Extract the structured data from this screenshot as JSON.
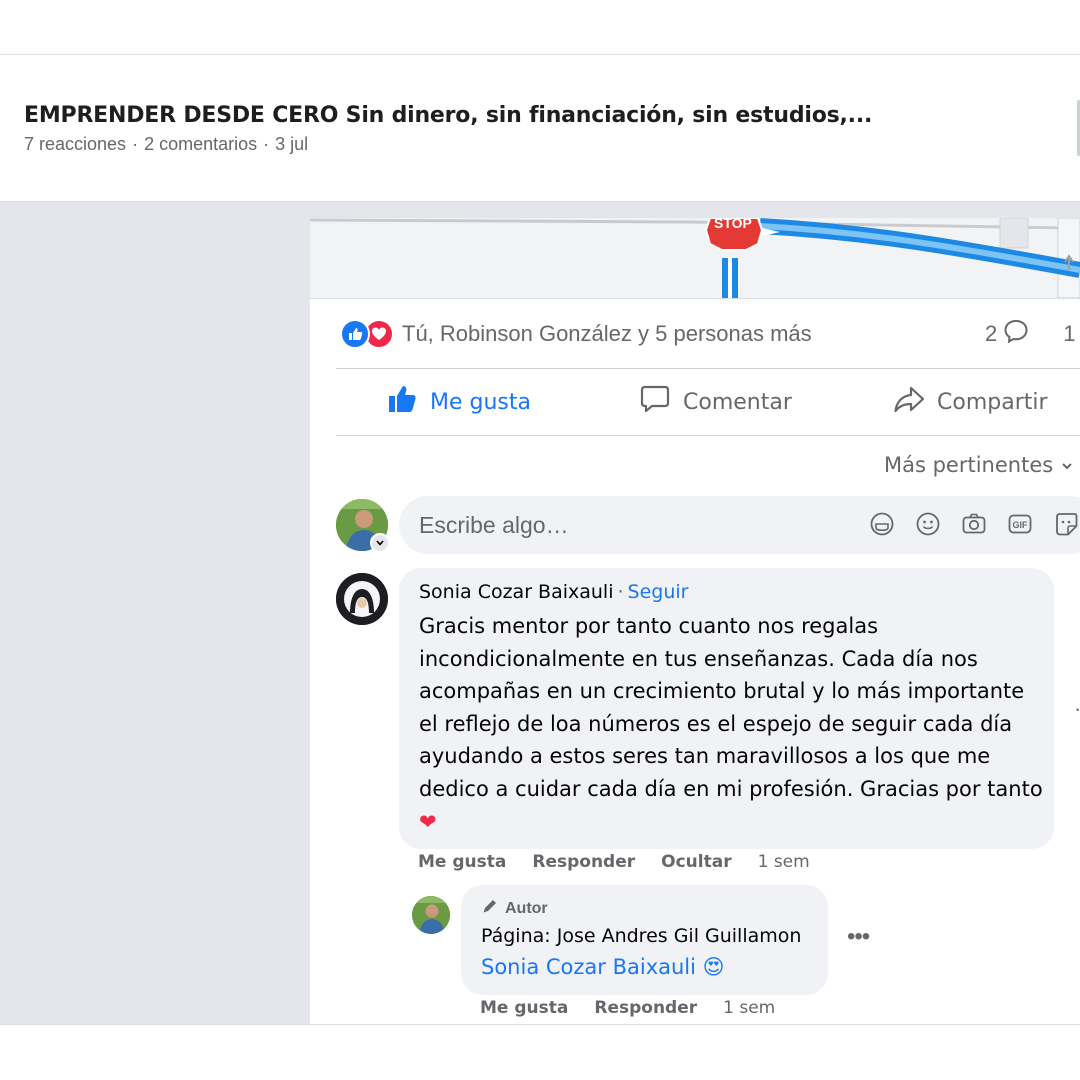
{
  "post": {
    "title": "EMPRENDER DESDE CERO Sin dinero, sin financiación, sin estudios,...",
    "reactions_count": "7 reacciones",
    "comments_count": "2 comentarios",
    "date": "3 jul"
  },
  "image": {
    "stop_sign_text": "STOP"
  },
  "engagement": {
    "reactors_text": "Tú, Robinson González y 5 personas más",
    "comments_number": "2",
    "shares_number": "1"
  },
  "actions": {
    "like": "Me gusta",
    "comment": "Comentar",
    "share": "Compartir"
  },
  "sort": {
    "label": "Más pertinentes"
  },
  "composer": {
    "placeholder": "Escribe algo…",
    "icons": [
      "sticker-icon",
      "emoji-icon",
      "camera-icon",
      "gif-icon",
      "avatar-sticker-icon"
    ]
  },
  "comments": [
    {
      "author": "Sonia Cozar Baixauli",
      "follow": "Seguir",
      "text": "Gracis mentor por tanto cuanto nos regalas incondicionalmente en tus enseñanzas. Cada día nos acompañas en un crecimiento brutal y lo más importante el reflejo de loa números es el espejo de seguir cada día ayudando a estos seres tan maravillosos a los que me dedico a cuidar cada día en mi profesión. Gracias por tanto",
      "emoji": "❤",
      "actions": {
        "like": "Me gusta",
        "reply": "Responder",
        "hide": "Ocultar",
        "time": "1 sem"
      },
      "reply": {
        "badge": "Autor",
        "author": "Página: Jose Andres Gil Guillamon",
        "mention": "Sonia Cozar Baixauli",
        "emoji": "😍",
        "actions": {
          "like": "Me gusta",
          "reply": "Responder",
          "time": "1 sem"
        }
      }
    }
  ],
  "colors": {
    "accent": "#1877f2",
    "love": "#f02849",
    "secondary_text": "#65676b",
    "bubble": "#f0f2f5",
    "background": "#e4e6eb"
  }
}
